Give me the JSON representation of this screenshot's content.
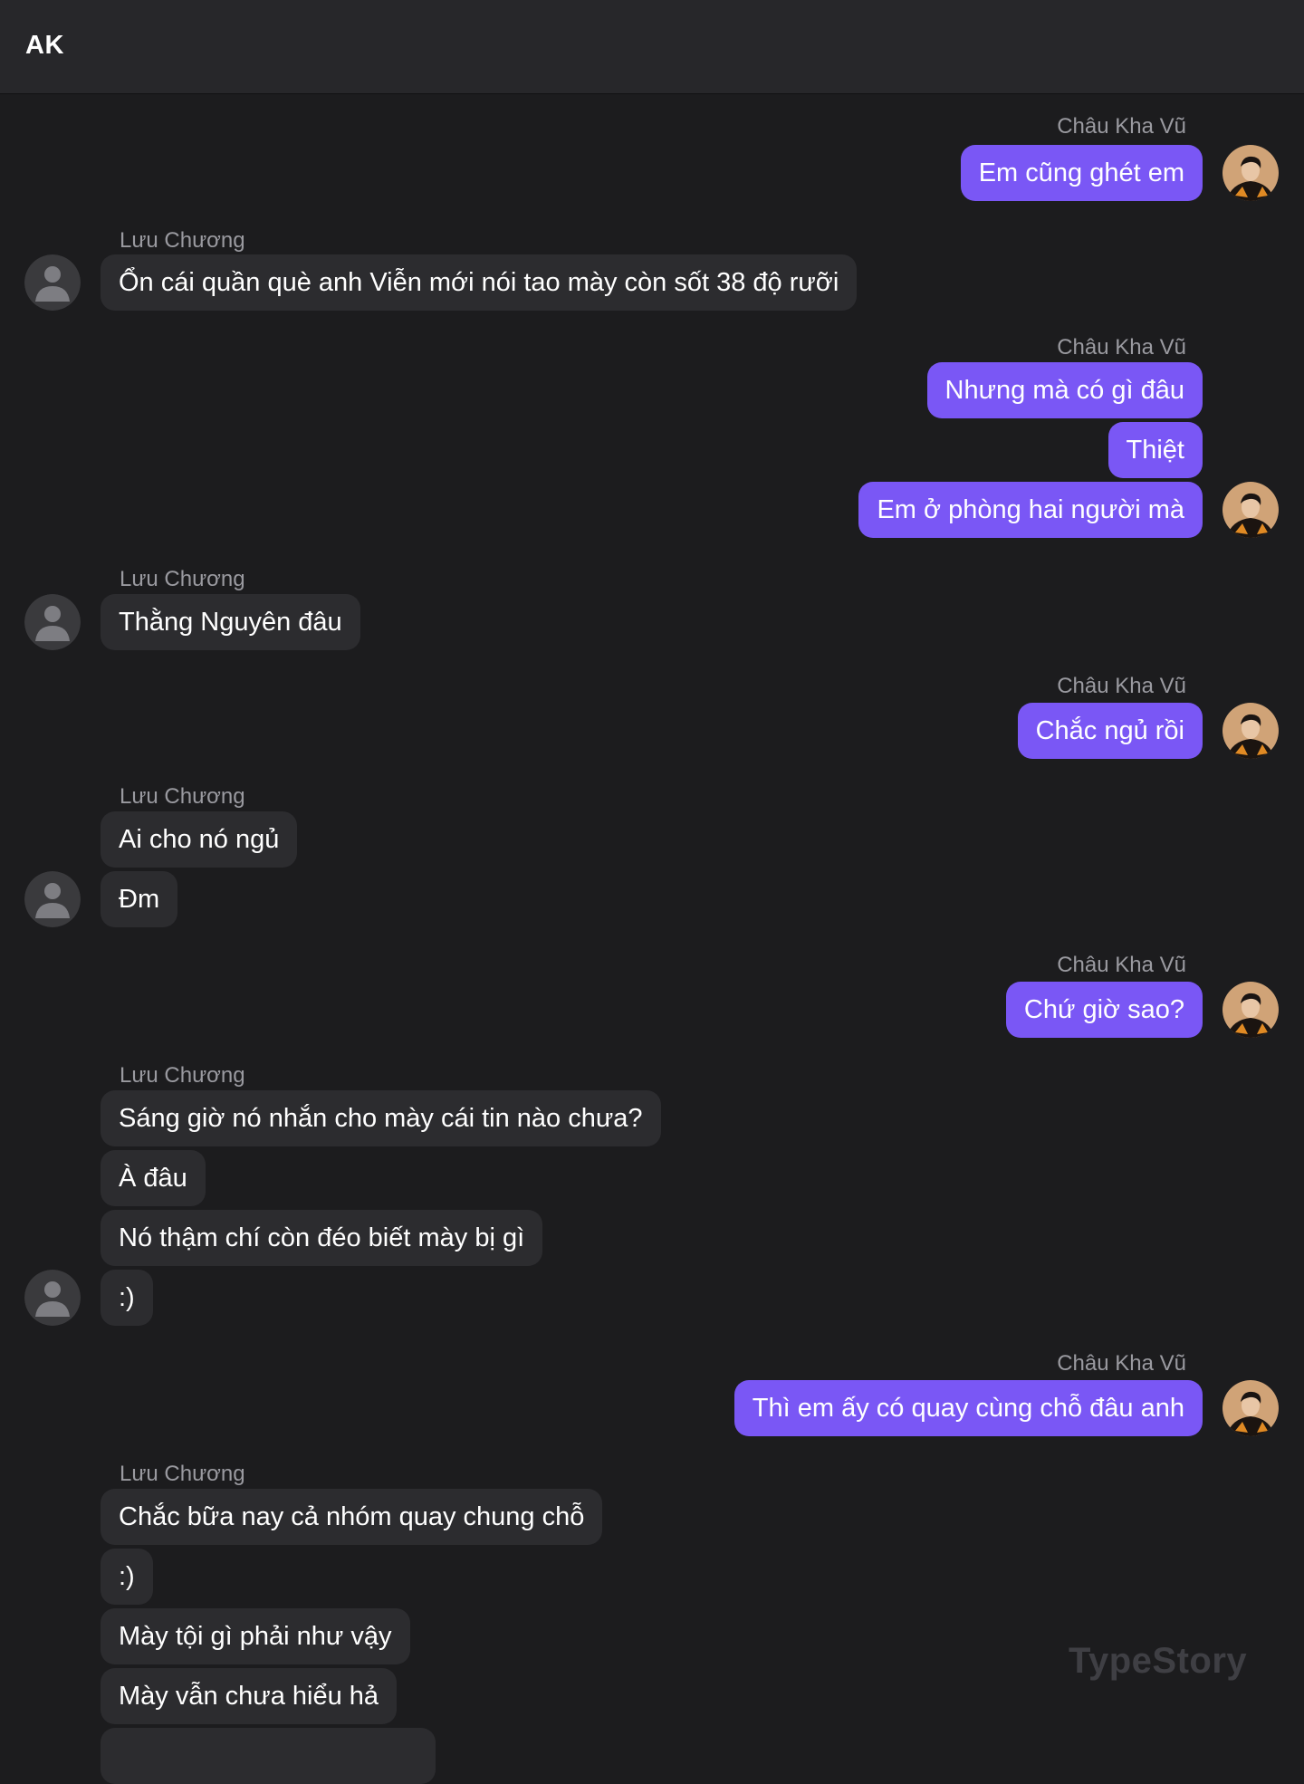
{
  "header": {
    "title": "AK"
  },
  "watermark": "TypeStory",
  "people": {
    "me": "Châu Kha Vũ",
    "other": "Lưu Chương"
  },
  "messages": [
    {
      "sender": "Châu Kha Vũ",
      "lines": [
        "Em cũng ghét em"
      ]
    },
    {
      "sender": "Lưu Chương",
      "lines": [
        "Ổn cái quần què anh Viễn mới nói tao mày còn sốt 38 độ rưỡi"
      ]
    },
    {
      "sender": "Châu Kha Vũ",
      "lines": [
        "Nhưng mà có gì đâu",
        "Thiệt",
        "Em ở phòng hai người mà"
      ]
    },
    {
      "sender": "Lưu Chương",
      "lines": [
        "Thằng Nguyên đâu"
      ]
    },
    {
      "sender": "Châu Kha Vũ",
      "lines": [
        "Chắc ngủ rồi"
      ]
    },
    {
      "sender": "Lưu Chương",
      "lines": [
        "Ai cho nó ngủ",
        "Đm"
      ]
    },
    {
      "sender": "Châu Kha Vũ",
      "lines": [
        "Chứ giờ sao?"
      ]
    },
    {
      "sender": "Lưu Chương",
      "lines": [
        "Sáng giờ nó nhắn cho mày cái tin nào chưa?",
        "À đâu",
        "Nó thậm chí còn đéo biết mày bị gì",
        ":)"
      ]
    },
    {
      "sender": "Châu Kha Vũ",
      "lines": [
        "Thì em ấy có quay cùng chỗ đâu anh"
      ]
    },
    {
      "sender": "Lưu Chương",
      "lines": [
        "Chắc bữa nay cả nhóm quay chung chỗ",
        ":)",
        "Mày tội gì phải như vậy",
        "Mày vẫn chưa hiểu hả"
      ]
    }
  ]
}
